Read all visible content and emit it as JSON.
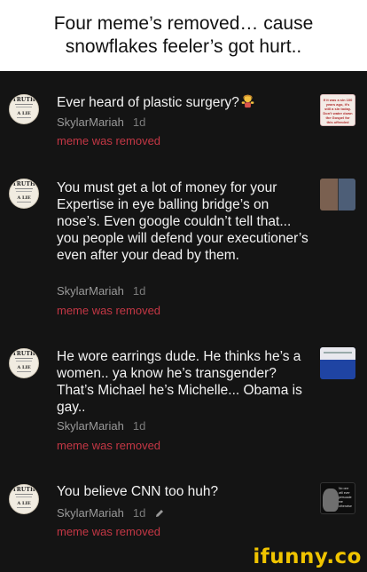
{
  "header": {
    "line1": "Four meme’s removed… cause",
    "line2": "snowflakes feeler’s got hurt.."
  },
  "avatar": {
    "top_word": "TRUTH",
    "bottom_word": "A LIE"
  },
  "comments": [
    {
      "text": "Ever heard of plastic surgery?",
      "author": "SkylarMariah",
      "age": "1d",
      "status": "meme was removed",
      "thumb_caption": "If it was a sin 100 years ago, it's still a sin today. Don't water down the Gospel for this offended"
    },
    {
      "text": "You must get a lot of money for your Expertise in eye balling bridge’s on nose’s. Even google couldn’t tell that... you people will defend your executioner’s even after your dead by them.",
      "author": "SkylarMariah",
      "age": "1d",
      "status": "meme was removed"
    },
    {
      "text": "He wore earrings dude. He thinks he’s a women.. ya know he’s transgender? That’s Michael he’s Michelle... Obama is gay..",
      "author": "SkylarMariah",
      "age": "1d",
      "status": "meme was removed"
    },
    {
      "text": "You believe CNN too huh?",
      "author": "SkylarMariah",
      "age": "1d",
      "status": "meme was removed",
      "thumb_caption": "No one will ever persuade me otherwise"
    }
  ],
  "watermark": "ifunny.co",
  "colors": {
    "feed_background": "#141414",
    "removed_text": "#c43745",
    "watermark": "#f0c400"
  }
}
